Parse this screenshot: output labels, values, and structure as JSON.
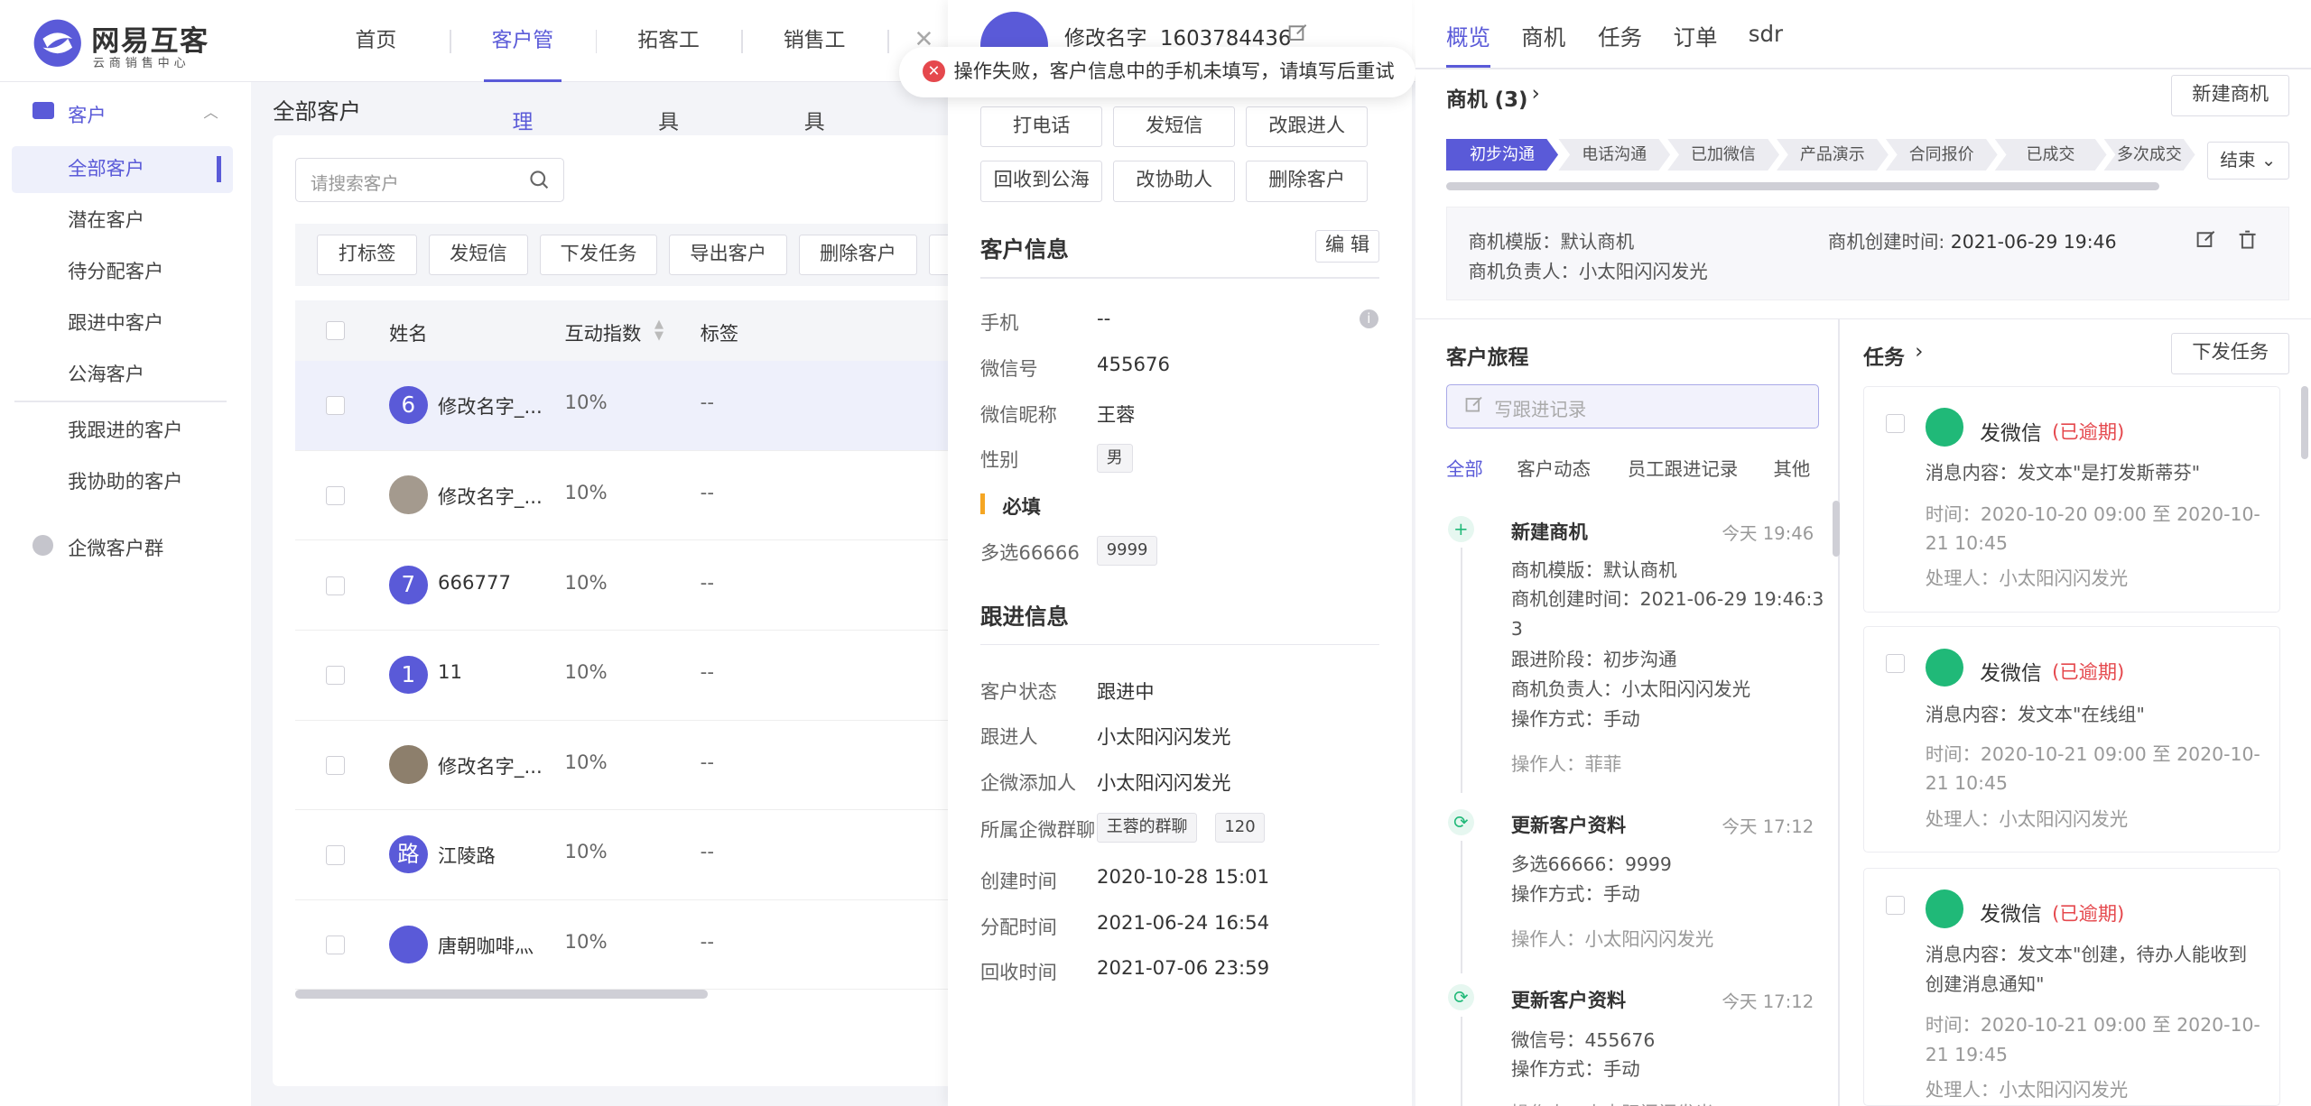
{
  "app": {
    "brand": "网易互客",
    "brand_sub": "云商销售中心",
    "colors": {
      "accent": "#5a5ad8",
      "success": "#20b978",
      "error": "#e5484d"
    }
  },
  "nav": {
    "items": [
      "首页",
      "客户管理",
      "拓客工具",
      "销售工具"
    ],
    "active": "客户管理"
  },
  "sidebar": {
    "group": "客户",
    "items": [
      "全部客户",
      "潜在客户",
      "待分配客户",
      "跟进中客户",
      "公海客户"
    ],
    "items2": [
      "我跟进的客户",
      "我协助的客户"
    ],
    "group2": "企微客户群"
  },
  "main": {
    "title": "全部客户",
    "search_placeholder": "请搜索客户",
    "toolbar": [
      "打标签",
      "发短信",
      "下发任务",
      "导出客户",
      "删除客户"
    ],
    "columns": [
      "姓名",
      "互动指数",
      "标签"
    ],
    "rows": [
      {
        "avatar": "6",
        "name": "修改名字_...",
        "index": "10%",
        "tag": "--"
      },
      {
        "avatar": "",
        "name": "修改名字_...",
        "index": "10%",
        "tag": "--"
      },
      {
        "avatar": "7",
        "name": "666777",
        "index": "10%",
        "tag": "--"
      },
      {
        "avatar": "1",
        "name": "11",
        "index": "10%",
        "tag": "--"
      },
      {
        "avatar": "",
        "name": "修改名字_...",
        "index": "10%",
        "tag": "--"
      },
      {
        "avatar": "路",
        "name": "江陵路",
        "index": "10%",
        "tag": "--"
      },
      {
        "avatar": "",
        "name": "唐朝咖啡灬",
        "index": "10%",
        "tag": "--"
      }
    ]
  },
  "toast": {
    "message": "操作失败，客户信息中的手机未填写，请填写后重试"
  },
  "detail": {
    "name": "修改名字",
    "phone": "1603784436",
    "actions": [
      "打电话",
      "发短信",
      "改跟进人",
      "回收到公海",
      "改协助人",
      "删除客户"
    ],
    "info_title": "客户信息",
    "edit": "编 辑",
    "fields": [
      {
        "label": "手机",
        "value": "--"
      },
      {
        "label": "微信号",
        "value": "455676"
      },
      {
        "label": "微信昵称",
        "value": "王蓉"
      }
    ],
    "gender_label": "性别",
    "gender": "男",
    "required": "必填",
    "multi_label": "多选66666",
    "multi_tag": "9999",
    "follow_title": "跟进信息",
    "follow": [
      {
        "label": "客户状态",
        "value": "跟进中"
      },
      {
        "label": "跟进人",
        "value": "小太阳闪闪发光"
      },
      {
        "label": "企微添加人",
        "value": "小太阳闪闪发光"
      }
    ],
    "group_label": "所属企微群聊",
    "group_tag": "王蓉的群聊",
    "group_count": "120",
    "times": [
      {
        "label": "创建时间",
        "value": "2020-10-28 15:01"
      },
      {
        "label": "分配时间",
        "value": "2021-06-24 16:54"
      },
      {
        "label": "回收时间",
        "value": "2021-07-06 23:59"
      }
    ]
  },
  "right": {
    "tabs": [
      "概览",
      "商机",
      "任务",
      "订单",
      "sdr"
    ],
    "opp_title": "商机 (3)",
    "new_opp": "新建商机",
    "stages": [
      "初步沟通",
      "电话沟通",
      "已加微信",
      "产品演示",
      "合同报价",
      "已成交",
      "多次成交"
    ],
    "end": "结束",
    "opp": {
      "template": "商机模版：默认商机",
      "owner": "商机负责人：小太阳闪闪发光",
      "created_label": "商机创建时间:",
      "created": "2021-06-29 19:46"
    },
    "journey_title": "客户旅程",
    "write_placeholder": "写跟进记录",
    "filters": [
      "全部",
      "客户动态",
      "员工跟进记录",
      "其他"
    ],
    "timeline": [
      {
        "title": "新建商机",
        "time": "今天 19:46",
        "lines": [
          "商机模版：默认商机",
          "商机创建时间：2021-06-29 19:46:3",
          "3",
          "跟进阶段：初步沟通",
          "商机负责人：小太阳闪闪发光",
          "操作方式：手动"
        ],
        "op": "操作人：菲菲"
      },
      {
        "title": "更新客户资料",
        "time": "今天 17:12",
        "lines": [
          "多选66666：9999",
          "操作方式：手动"
        ],
        "op": "操作人：小太阳闪闪发光"
      },
      {
        "title": "更新客户资料",
        "time": "今天 17:12",
        "lines": [
          "微信号：455676",
          "操作方式：手动"
        ],
        "op": "操作人：小太阳闪闪发光"
      }
    ],
    "task_title": "任务",
    "new_task": "下发任务",
    "tasks": [
      {
        "title": "发微信",
        "status": "(已逾期)",
        "content": "消息内容：发文本\"是打发斯蒂芬\"",
        "time1": "时间：2020-10-20 09:00 至 2020-10-",
        "time2": "21 10:45",
        "handler": "处理人：小太阳闪闪发光"
      },
      {
        "title": "发微信",
        "status": "(已逾期)",
        "content": "消息内容：发文本\"在线组\"",
        "time1": "时间：2020-10-21 09:00 至 2020-10-",
        "time2": "21 10:45",
        "handler": "处理人：小太阳闪闪发光"
      },
      {
        "title": "发微信",
        "status": "(已逾期)",
        "content": "消息内容：发文本\"创建，待办人能收到",
        "content2": "创建消息通知\"",
        "time1": "时间：2020-10-21 09:00 至 2020-10-",
        "time2": "21 19:45",
        "handler": "处理人：小太阳闪闪发光"
      }
    ]
  }
}
